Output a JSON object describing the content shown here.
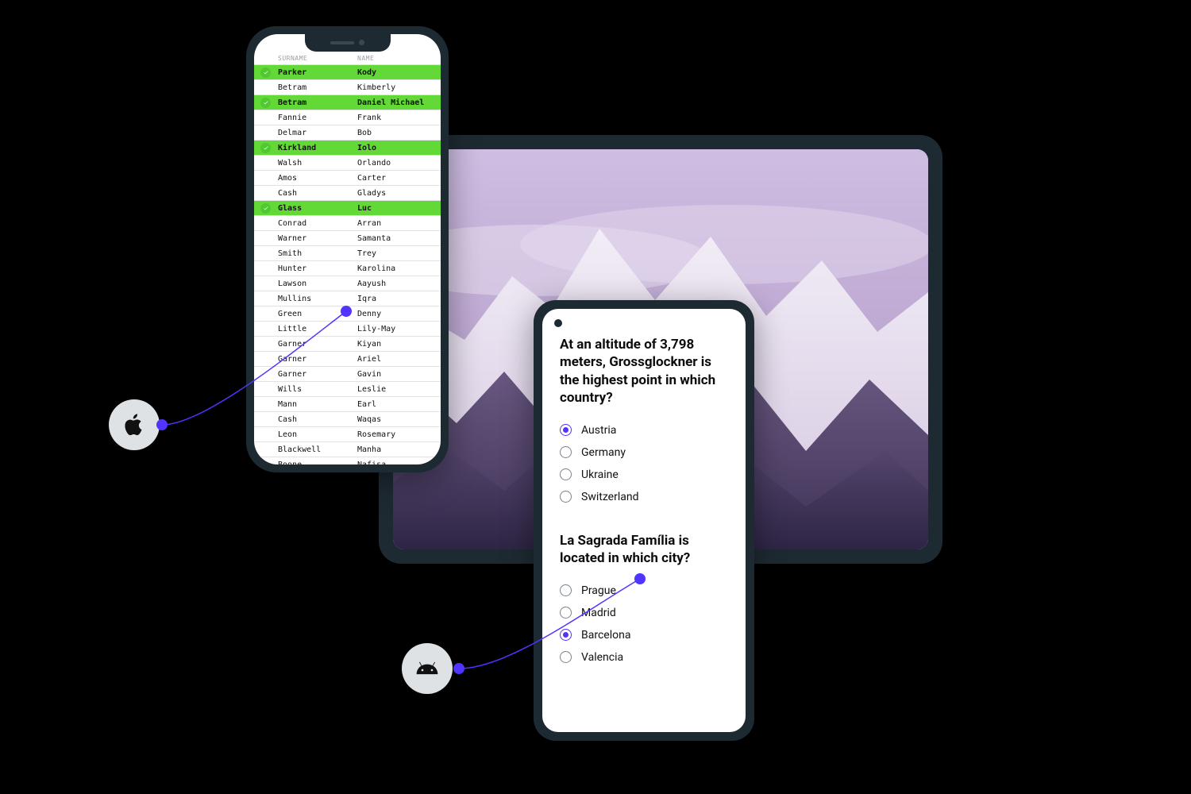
{
  "colors": {
    "accent": "#5034ff",
    "highlight": "#62d936",
    "frame": "#1e2a32"
  },
  "icons": {
    "apple": "apple-icon",
    "android": "android-icon",
    "check": "check-icon"
  },
  "iphone": {
    "headers": {
      "surname": "SURNAME",
      "name": "NAME"
    },
    "rows": [
      {
        "surname": "Parker",
        "name": "Kody",
        "highlighted": true
      },
      {
        "surname": "Betram",
        "name": "Kimberly",
        "highlighted": false
      },
      {
        "surname": "Betram",
        "name": "Daniel Michael",
        "highlighted": true
      },
      {
        "surname": "Fannie",
        "name": "Frank",
        "highlighted": false
      },
      {
        "surname": "Delmar",
        "name": "Bob",
        "highlighted": false
      },
      {
        "surname": "Kirkland",
        "name": "Iolo",
        "highlighted": true
      },
      {
        "surname": "Walsh",
        "name": "Orlando",
        "highlighted": false
      },
      {
        "surname": "Amos",
        "name": "Carter",
        "highlighted": false
      },
      {
        "surname": "Cash",
        "name": "Gladys",
        "highlighted": false
      },
      {
        "surname": "Glass",
        "name": "Luc",
        "highlighted": true
      },
      {
        "surname": "Conrad",
        "name": "Arran",
        "highlighted": false
      },
      {
        "surname": "Warner",
        "name": "Samanta",
        "highlighted": false
      },
      {
        "surname": "Smith",
        "name": "Trey",
        "highlighted": false
      },
      {
        "surname": "Hunter",
        "name": "Karolina",
        "highlighted": false
      },
      {
        "surname": "Lawson",
        "name": "Aayush",
        "highlighted": false
      },
      {
        "surname": "Mullins",
        "name": "Iqra",
        "highlighted": false
      },
      {
        "surname": "Green",
        "name": "Denny",
        "highlighted": false
      },
      {
        "surname": "Little",
        "name": "Lily-May",
        "highlighted": false
      },
      {
        "surname": "Garner",
        "name": "Kiyan",
        "highlighted": false
      },
      {
        "surname": "Garner",
        "name": "Ariel",
        "highlighted": false
      },
      {
        "surname": "Garner",
        "name": "Gavin",
        "highlighted": false
      },
      {
        "surname": "Wills",
        "name": "Leslie",
        "highlighted": false
      },
      {
        "surname": "Mann",
        "name": "Earl",
        "highlighted": false
      },
      {
        "surname": "Cash",
        "name": "Waqas",
        "highlighted": false
      },
      {
        "surname": "Leon",
        "name": "Rosemary",
        "highlighted": false
      },
      {
        "surname": "Blackwell",
        "name": "Manha",
        "highlighted": false
      },
      {
        "surname": "Boone",
        "name": "Nafisa",
        "highlighted": false
      }
    ]
  },
  "android": {
    "q1": {
      "text": "At an altitude of 3,798 meters, Grossglockner is the highest point in which country?",
      "options": [
        "Austria",
        "Germany",
        "Ukraine",
        "Switzerland"
      ],
      "selected": 0
    },
    "q2": {
      "text": "La Sagrada Família is located in which city?",
      "options": [
        "Prague",
        "Madrid",
        "Barcelona",
        "Valencia"
      ],
      "selected": 2
    }
  }
}
